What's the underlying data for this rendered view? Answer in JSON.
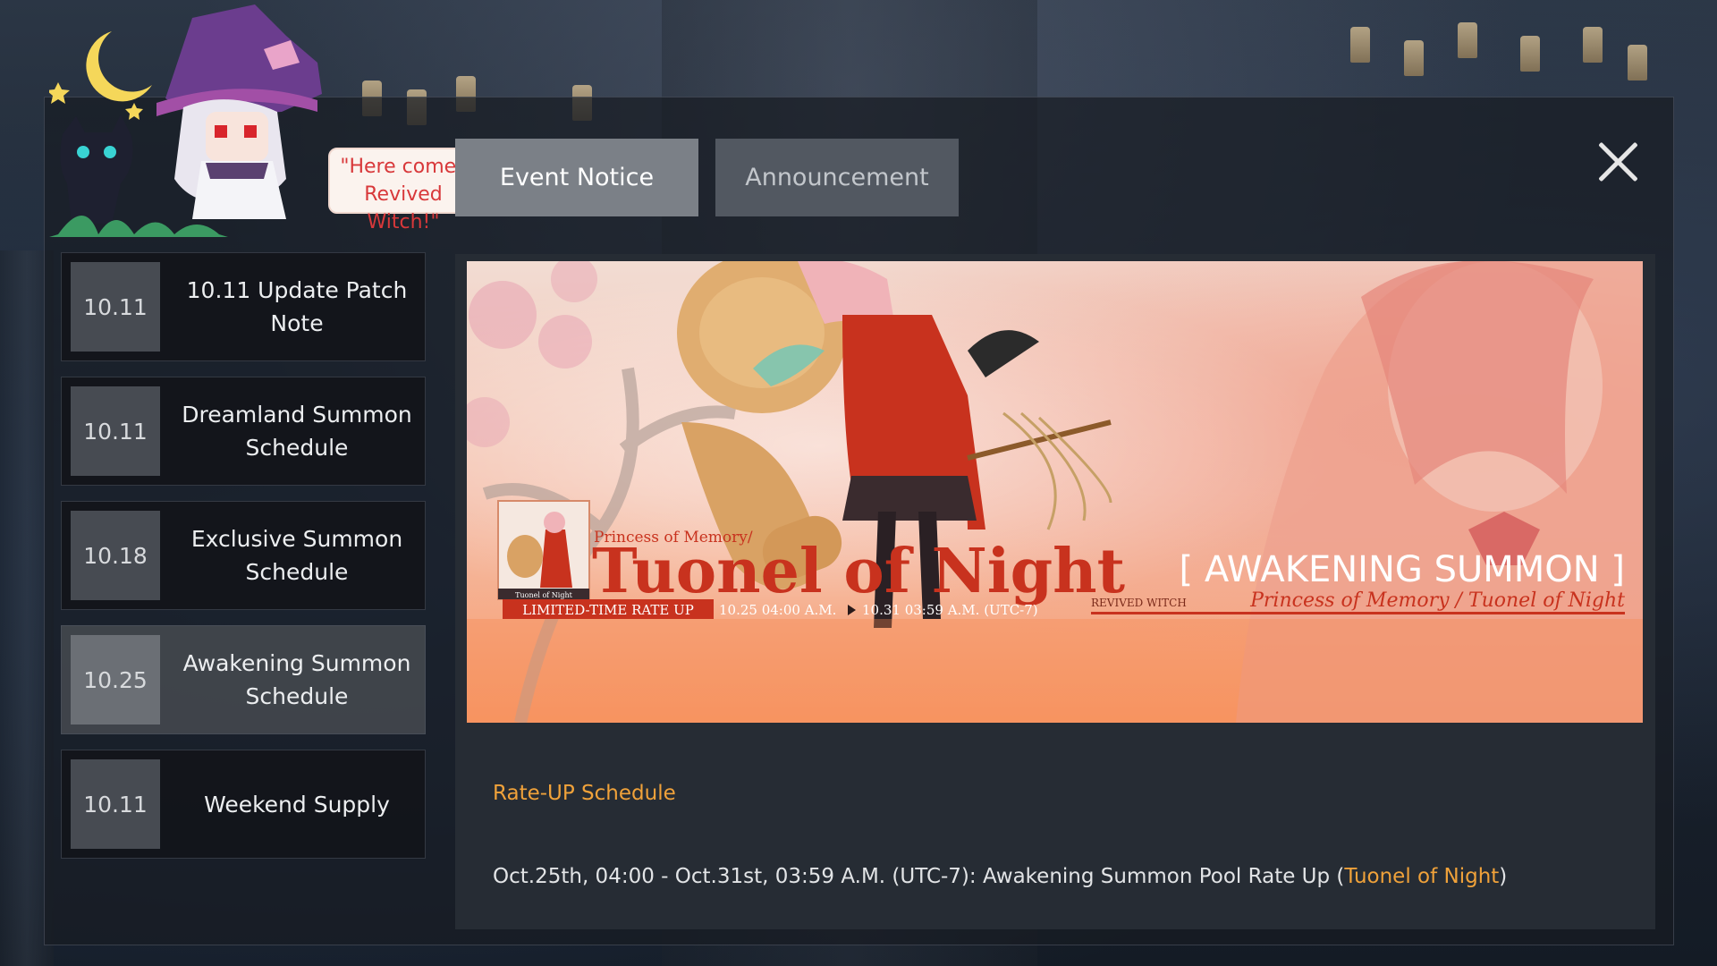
{
  "mascot": {
    "speech_line1": "\"Here comes",
    "speech_line2": "Revived Witch!\""
  },
  "tabs": [
    {
      "label": "Event Notice",
      "active": true
    },
    {
      "label": "Announcement",
      "active": false
    }
  ],
  "sidebar": {
    "items": [
      {
        "date": "10.11",
        "title": "10.11 Update Patch Note",
        "selected": false
      },
      {
        "date": "10.11",
        "title": "Dreamland Summon Schedule",
        "selected": false
      },
      {
        "date": "10.18",
        "title": "Exclusive Summon Schedule",
        "selected": false
      },
      {
        "date": "10.25",
        "title": "Awakening Summon Schedule",
        "selected": true
      },
      {
        "date": "10.11",
        "title": "Weekend Supply",
        "selected": false
      }
    ]
  },
  "banner": {
    "subtitle": "Princess of Memory/",
    "title": "Tuonel of Night",
    "portrait_caption": "Tuonel of Night",
    "rate_up_tag": "LIMITED-TIME RATE UP",
    "start_time": "10.25 04:00 A.M.",
    "end_time": "10.31 03:59 A.M. (UTC-7)",
    "summon_title": "[ AWAKENING SUMMON ]",
    "revived_label": "REVIVED WITCH",
    "revived_name": "Princess of Memory / Tuonel of Night"
  },
  "content": {
    "heading": "Rate-UP Schedule",
    "body_prefix": "Oct.25th, 04:00 - Oct.31st, 03:59 A.M. (UTC-7): Awakening Summon Pool Rate Up (",
    "body_highlight": "Tuonel of Night",
    "body_suffix": ")"
  },
  "colors": {
    "accent": "#f0a23a",
    "banner_red": "#c8321e",
    "tab_active": "#7b8087",
    "tab_inactive": "#525861"
  },
  "icons": {
    "close": "close-icon",
    "moon": "moon-icon",
    "play_arrow": "play-arrow-icon"
  }
}
